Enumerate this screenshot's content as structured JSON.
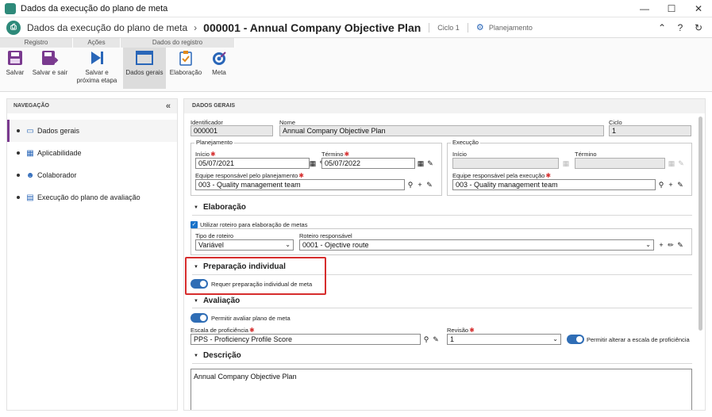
{
  "window": {
    "title": "Dados da execução do plano de meta",
    "min": "—",
    "max": "☐",
    "close": "✕"
  },
  "header": {
    "logo": "⎙",
    "crumb": "Dados da execução do plano de meta",
    "separator": "›",
    "record_title": "000001 - Annual Company Objective Plan",
    "cycle": "Ciclo 1",
    "status": "Planejamento",
    "status_icon": "⚙"
  },
  "ribbon": {
    "groups": [
      "Registro",
      "Ações",
      "Dados do registro"
    ],
    "buttons": {
      "save": "Salvar",
      "save_exit": "Salvar e sair",
      "save_next": "Salvar e próxima etapa",
      "general": "Dados gerais",
      "elaboration": "Elaboração",
      "goal": "Meta"
    }
  },
  "nav": {
    "title": "NAVEGAÇÃO",
    "collapse": "«",
    "items": [
      {
        "label": "Dados gerais",
        "selected": true
      },
      {
        "label": "Aplicabilidade",
        "selected": false
      },
      {
        "label": "Colaborador",
        "selected": false
      },
      {
        "label": "Execução do plano de avaliação",
        "selected": false
      }
    ]
  },
  "main": {
    "title": "DADOS GERAIS",
    "identifier_label": "Identificador",
    "identifier_value": "000001",
    "name_label": "Nome",
    "name_value": "Annual Company Objective Plan",
    "cycle_label": "Ciclo",
    "cycle_value": "1",
    "planning": {
      "legend": "Planejamento",
      "start_label": "Início",
      "start_value": "05/07/2021",
      "end_label": "Término",
      "end_value": "05/07/2022",
      "team_label": "Equipe responsável pelo planejamento",
      "team_value": "003 - Quality management team"
    },
    "execution": {
      "legend": "Execução",
      "start_label": "Início",
      "start_value": "",
      "end_label": "Término",
      "end_value": "",
      "team_label": "Equipe responsável pela execução",
      "team_value": "003 - Quality management team"
    },
    "elaboration": {
      "title": "Elaboração",
      "use_route_label": "Utilizar roteiro para elaboração de metas",
      "route_type_label": "Tipo de roteiro",
      "route_type_value": "Variável",
      "route_label": "Roteiro responsável",
      "route_value": "0001 - Ojective route"
    },
    "individual": {
      "title": "Preparação individual",
      "requires_label": "Requer preparação individual de meta"
    },
    "evaluation": {
      "title": "Avaliação",
      "allow_label": "Permitir avaliar plano de meta",
      "scale_label": "Escala de proficiência",
      "scale_value": "PPS - Proficiency Profile Score",
      "revision_label": "Revisão",
      "revision_value": "1",
      "allow_change_label": "Permitir alterar a escala de proficiência"
    },
    "description": {
      "title": "Descrição",
      "value": "Annual Company Objective Plan"
    }
  },
  "glyphs": {
    "required": "✱",
    "triangle": "▼",
    "calendar": "▦",
    "eraser": "✎",
    "search": "⚲",
    "plus": "+",
    "edit": "✏",
    "dropdown": "⌄",
    "check": "✓"
  }
}
